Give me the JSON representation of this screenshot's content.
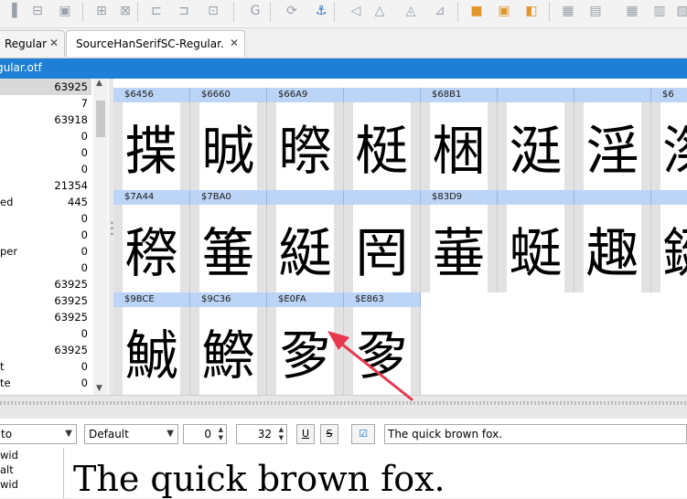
{
  "toolbar": {
    "icons": [
      "align-left-icon",
      "align-center-icon",
      "align-right-icon",
      "distribute-h-icon",
      "distribute-v-icon",
      "align-top-icon",
      "align-middle-icon",
      "align-bottom-icon",
      "glyph-g-icon",
      "rotate-icon",
      "anchor-icon",
      "flip-h-icon",
      "flip-v-icon",
      "skew-icon",
      "transform-icon",
      "union-icon",
      "intersect-icon",
      "subtract-icon",
      "grid-icon",
      "grid-toggle-icon",
      "table-icon",
      "table-alt-icon",
      "table-compact-icon"
    ]
  },
  "tabs": [
    {
      "label": "Source Sans Regular",
      "visible_label": "Regular"
    },
    {
      "label": "SourceHanSerifSC-Regular.otf",
      "visible_label": "SourceHanSerifSC-Regular."
    }
  ],
  "path": "gular.otf",
  "left_panel": {
    "rows": [
      {
        "label": "",
        "value": "63925",
        "selected": true
      },
      {
        "label": "",
        "value": "7"
      },
      {
        "label": "",
        "value": "63918"
      },
      {
        "label": "",
        "value": "0"
      },
      {
        "label": "",
        "value": "0"
      },
      {
        "label": "",
        "value": "0"
      },
      {
        "label": "",
        "value": "21354"
      },
      {
        "label": "ed",
        "value": "445"
      },
      {
        "label": "",
        "value": "0"
      },
      {
        "label": "",
        "value": "0"
      },
      {
        "label": "per",
        "value": "0"
      },
      {
        "label": "",
        "value": "0"
      },
      {
        "label": "",
        "value": "63925"
      },
      {
        "label": "",
        "value": "63925"
      },
      {
        "label": "",
        "value": "63925"
      },
      {
        "label": "",
        "value": "0"
      },
      {
        "label": "",
        "value": "63925"
      },
      {
        "label": "t",
        "value": "0"
      },
      {
        "label": "te",
        "value": "0"
      },
      {
        "label": "",
        "value": "0"
      }
    ]
  },
  "grid": {
    "rows": [
      [
        {
          "code": "$6456",
          "glyph": "揲"
        },
        {
          "code": "$6660",
          "glyph": "晠"
        },
        {
          "code": "$66A9",
          "glyph": "暩"
        },
        {
          "code": "",
          "glyph": "梃"
        },
        {
          "code": "$68B1",
          "glyph": "梱"
        },
        {
          "code": "",
          "glyph": "涏"
        },
        {
          "code": "",
          "glyph": "淫"
        },
        {
          "code": "$6",
          "glyph": "滐"
        }
      ],
      [
        {
          "code": "$7A44",
          "glyph": "穄"
        },
        {
          "code": "$7BA0",
          "glyph": "箠"
        },
        {
          "code": "",
          "glyph": "綎"
        },
        {
          "code": "",
          "glyph": "罔"
        },
        {
          "code": "$83D9",
          "glyph": "菙"
        },
        {
          "code": "",
          "glyph": "蜓"
        },
        {
          "code": "",
          "glyph": "趣"
        },
        {
          "code": "",
          "glyph": "鋌"
        }
      ],
      [
        {
          "code": "$9BCE",
          "glyph": "鯎"
        },
        {
          "code": "$9C36",
          "glyph": "鰶"
        },
        {
          "code": "$E0FA",
          "glyph": "㚉"
        },
        {
          "code": "$E863",
          "glyph": "㚉"
        }
      ]
    ]
  },
  "preview": {
    "feature_select": "to",
    "mode_select": "Default",
    "offset_value": "0",
    "size_value": "32",
    "underline_label": "U",
    "strike_label": "S",
    "sample_text": "The quick brown fox.",
    "features": [
      "wid",
      "alt",
      "wid"
    ],
    "render_text": "The quick brown fox."
  },
  "colors": {
    "accent": "#1e7fd4",
    "grid_header": "#bcd4f6",
    "annotation": "#e8384f"
  }
}
